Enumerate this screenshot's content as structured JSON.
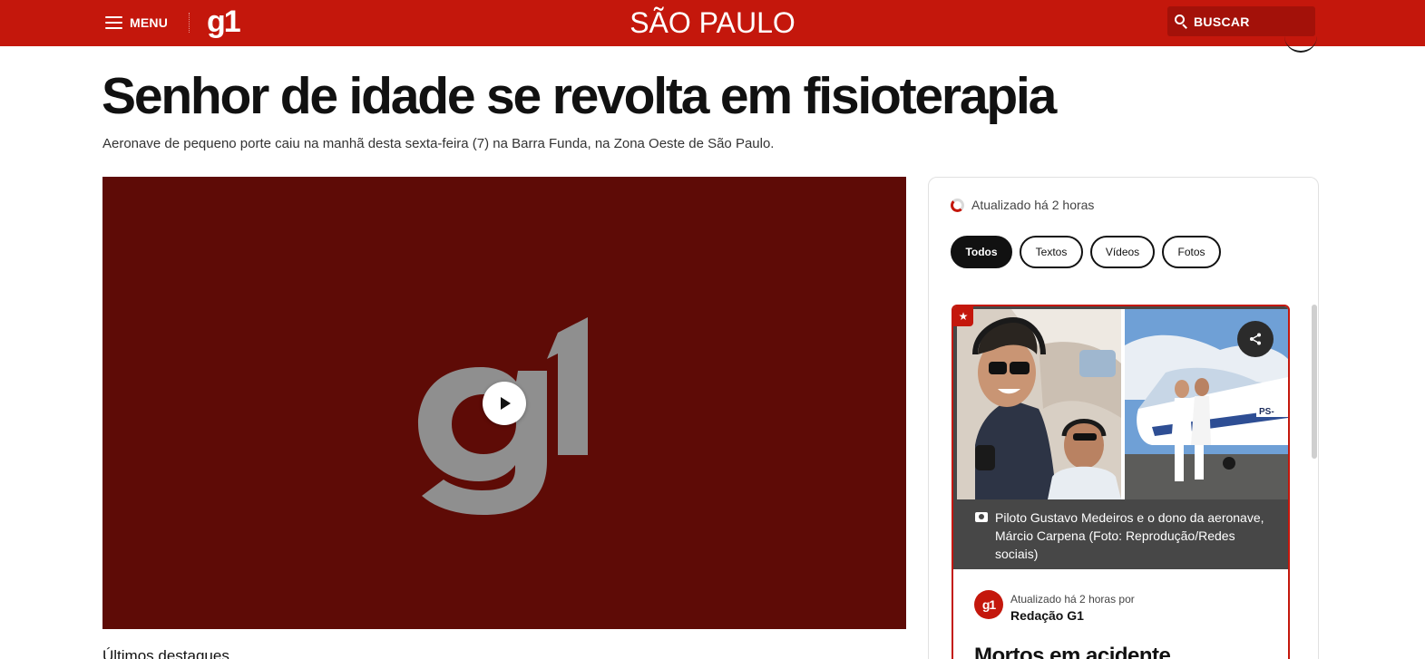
{
  "header": {
    "menu_label": "MENU",
    "logo": "g1",
    "section": "SÃO PAULO",
    "search_label": "BUSCAR",
    "brand_color": "#c4170c",
    "icons": [
      "hamburger-icon",
      "search-icon"
    ]
  },
  "article": {
    "headline": "Senhor de idade se revolta em fisioterapia",
    "subtitle": "Aeronave de pequeno porte caiu na manhã desta sexta-feira (7) na Barra Funda, na Zona Oeste de São Paulo.",
    "video": {
      "logo": "g1",
      "background_color": "#5e0b06",
      "play_icon": "play-icon"
    },
    "below_video": "Últimos destaques"
  },
  "live_feed": {
    "updated": "Atualizado há 2 horas",
    "filters": [
      {
        "label": "Todos",
        "active": true
      },
      {
        "label": "Textos",
        "active": false
      },
      {
        "label": "Vídeos",
        "active": false
      },
      {
        "label": "Fotos",
        "active": false
      }
    ],
    "post": {
      "highlight_icon": "star-icon",
      "share_icon": "share-icon",
      "caption": "Piloto Gustavo Medeiros e o dono da aeronave, Márcio Carpena (Foto: Reprodução/Redes sociais)",
      "author_logo": "g1",
      "author_time": "Atualizado há 2 horas por",
      "author_name": "Redação G1",
      "title": "Mortos em acidente"
    }
  }
}
